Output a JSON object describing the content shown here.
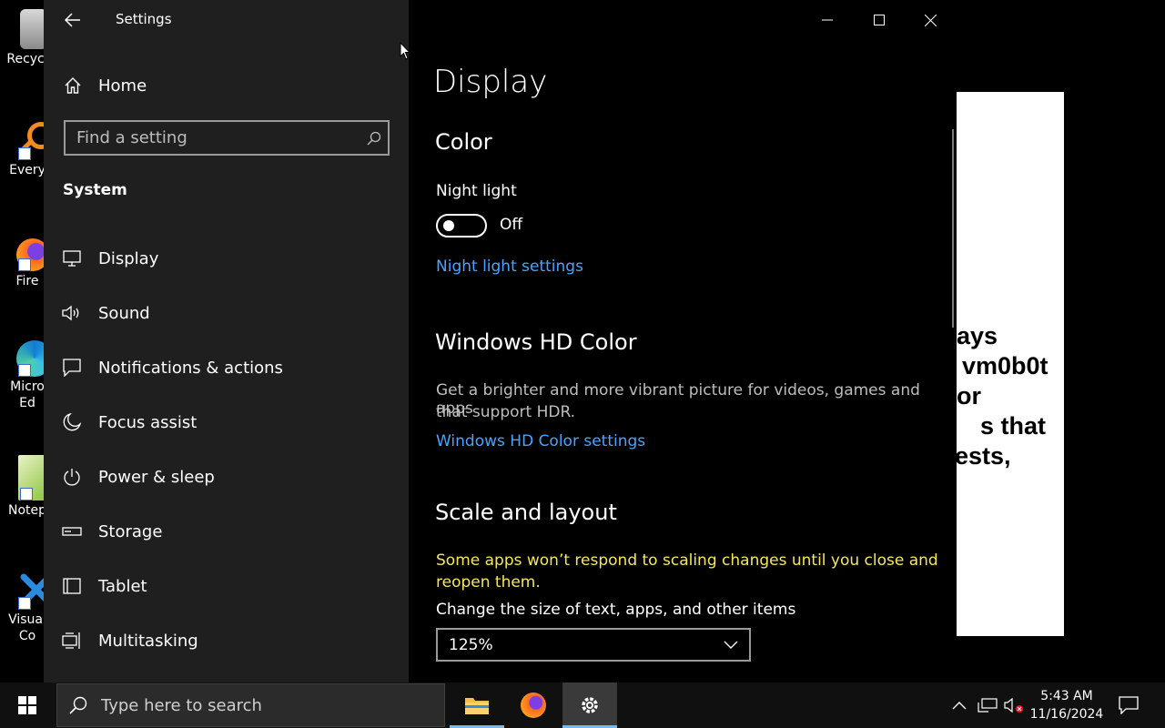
{
  "desktop": {
    "icons": [
      {
        "name": "recycle-bin",
        "label": "Recycl"
      },
      {
        "name": "everything",
        "label": "Every"
      },
      {
        "name": "firefox",
        "label": "Fire"
      },
      {
        "name": "edge",
        "label": "Micro\nEd"
      },
      {
        "name": "notepad",
        "label": "Notep"
      },
      {
        "name": "vscode",
        "label": "Visual\nCo"
      }
    ]
  },
  "background_window": {
    "lines": [
      "ays",
      "vm0b0t",
      "or",
      "s that",
      "ests,"
    ]
  },
  "settings": {
    "title": "Settings",
    "home_label": "Home",
    "search_placeholder": "Find a setting",
    "section": "System",
    "nav": [
      {
        "label": "Display",
        "icon": "monitor-icon"
      },
      {
        "label": "Sound",
        "icon": "speaker-icon"
      },
      {
        "label": "Notifications & actions",
        "icon": "notification-icon"
      },
      {
        "label": "Focus assist",
        "icon": "moon-icon"
      },
      {
        "label": "Power & sleep",
        "icon": "power-icon"
      },
      {
        "label": "Storage",
        "icon": "storage-icon"
      },
      {
        "label": "Tablet",
        "icon": "tablet-icon"
      },
      {
        "label": "Multitasking",
        "icon": "multitasking-icon"
      }
    ],
    "content": {
      "page_title": "Display",
      "color_heading": "Color",
      "night_light_label": "Night light",
      "night_light_state": "Off",
      "night_light_on": false,
      "night_light_settings_link": "Night light settings",
      "hd_heading": "Windows HD Color",
      "hd_desc_line1": "Get a brighter and more vibrant picture for videos, games and apps",
      "hd_desc_line2": "that support HDR.",
      "hd_settings_link": "Windows HD Color settings",
      "scale_heading": "Scale and layout",
      "scale_warning_line1": "Some apps won’t respond to scaling changes until you close and",
      "scale_warning_line2": "reopen them.",
      "scale_label": "Change the size of text, apps, and other items",
      "scale_value": "125%"
    }
  },
  "taskbar": {
    "search_placeholder": "Type here to search",
    "clock_time": "5:43 AM",
    "clock_date": "11/16/2024",
    "accent": "#76b9ed"
  }
}
